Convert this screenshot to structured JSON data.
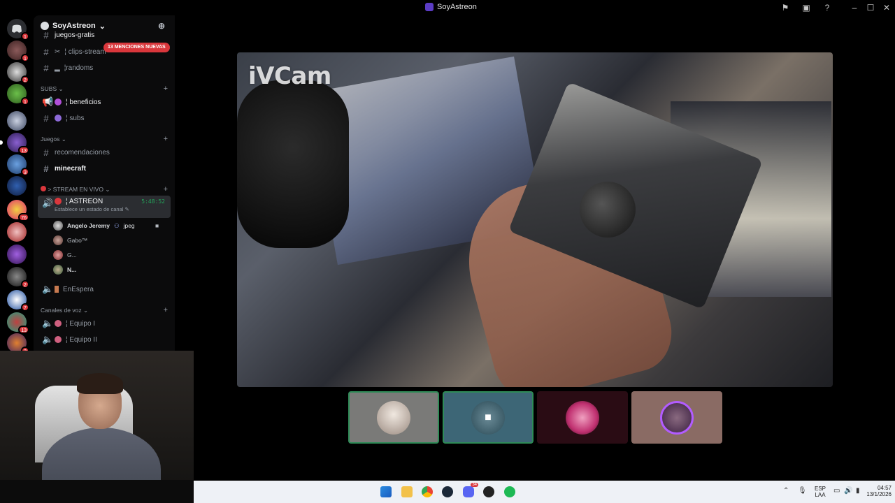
{
  "window": {
    "title": "SoyAstreon"
  },
  "server": {
    "name": "SoyAstreon",
    "mention_pill": "13 MENCIONES NUEVAS"
  },
  "server_badges": [
    "1",
    "1",
    "2",
    "1",
    "13",
    "3",
    "76",
    "2",
    "7",
    "13",
    "2"
  ],
  "channels": {
    "partial_top": "juegos-gratis",
    "clips": "¦ clips-stream",
    "randoms": "¦randoms",
    "cat_subs": "SUBS",
    "beneficios": "¦ beneficios",
    "subs": "¦ subs",
    "cat_juegos": "Juegos",
    "recomendaciones": "recomendaciones",
    "minecraft": "minecraft",
    "cat_stream": "> STREAM EN VIVO",
    "astreon": "¦ ASTREON",
    "astreon_time": "5:48:52",
    "astreon_status": "Establece un estado de canal ✎",
    "enespera": "EnEspera",
    "cat_voz": "Canales de voz",
    "equipo1": "¦ Equipo I",
    "equipo2": "¦ Equipo II"
  },
  "voice_users": [
    {
      "name": "Angelo Jeremy",
      "tag": "jpeg"
    },
    {
      "name": "Gabo™"
    },
    {
      "name": "G..."
    },
    {
      "name": "N..."
    }
  ],
  "video": {
    "watermark": "iVCam"
  },
  "taskbar": {
    "lang_top": "ESP",
    "lang_bottom": "LAA",
    "time": "04:57",
    "date": "13/1/2026",
    "discord_badge": "34"
  },
  "colors": {
    "accent_red": "#da373c",
    "online_green": "#23a55a",
    "blurple": "#5865f2"
  }
}
